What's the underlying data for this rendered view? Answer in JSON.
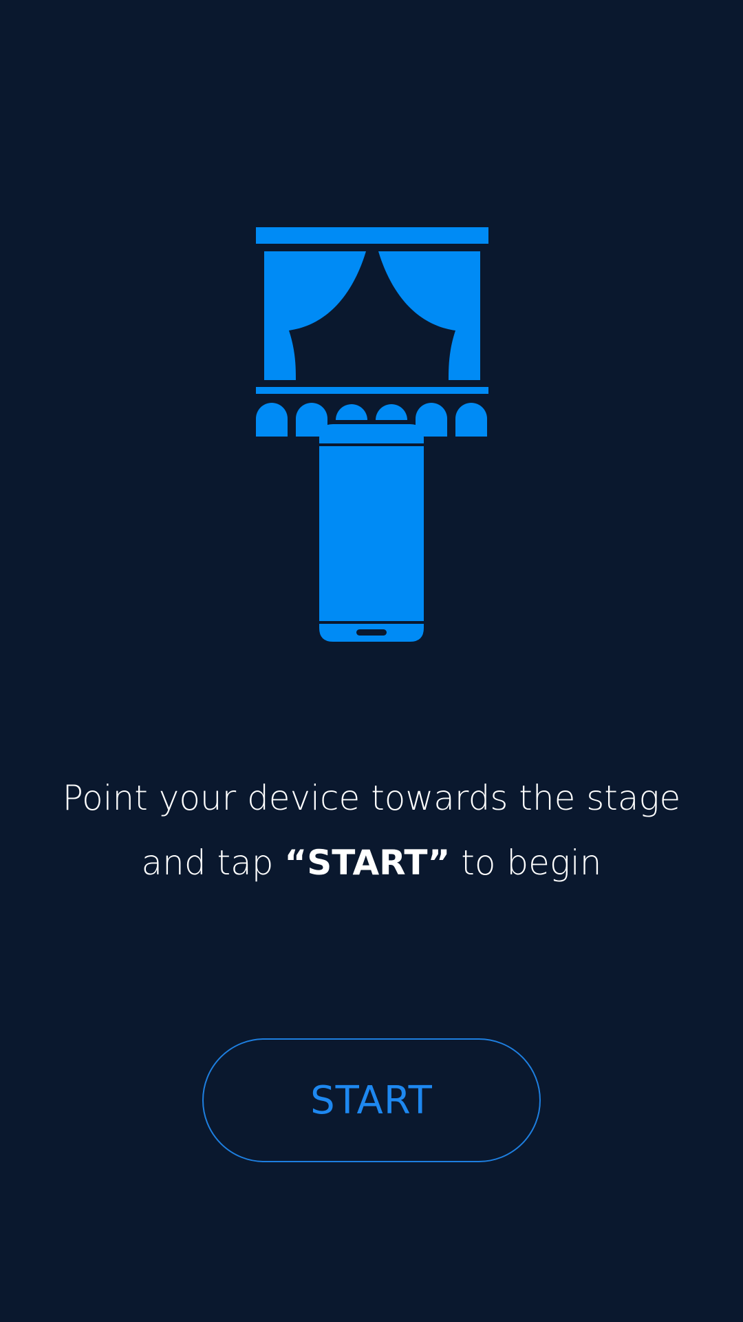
{
  "theme": {
    "background": "#0a182e",
    "accent": "#008bf5",
    "text": "#ffffff"
  },
  "illustration": {
    "icon": "stage-with-phone-icon"
  },
  "instruction": {
    "line1": "Point your device towards the stage",
    "line2_prefix": "and tap ",
    "line2_emphasis": "“START”",
    "line2_suffix": " to begin"
  },
  "start_button": {
    "label": "START"
  }
}
